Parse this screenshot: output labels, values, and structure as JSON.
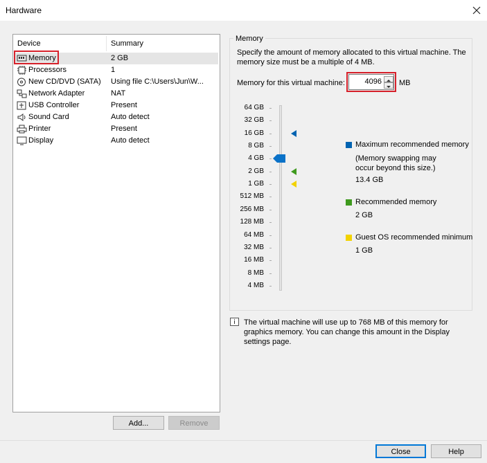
{
  "window": {
    "title": "Hardware",
    "close_icon": "close-icon"
  },
  "device_list": {
    "columns": {
      "device": "Device",
      "summary": "Summary"
    },
    "rows": [
      {
        "name": "Memory",
        "summary": "2 GB",
        "icon": "memory-icon",
        "selected": true
      },
      {
        "name": "Processors",
        "summary": "1",
        "icon": "processor-icon"
      },
      {
        "name": "New CD/DVD (SATA)",
        "summary": "Using file C:\\Users\\Jun\\W...",
        "icon": "cd-dvd-icon"
      },
      {
        "name": "Network Adapter",
        "summary": "NAT",
        "icon": "network-adapter-icon"
      },
      {
        "name": "USB Controller",
        "summary": "Present",
        "icon": "usb-controller-icon"
      },
      {
        "name": "Sound Card",
        "summary": "Auto detect",
        "icon": "sound-card-icon"
      },
      {
        "name": "Printer",
        "summary": "Present",
        "icon": "printer-icon"
      },
      {
        "name": "Display",
        "summary": "Auto detect",
        "icon": "display-icon"
      }
    ],
    "add_label": "Add...",
    "remove_label": "Remove"
  },
  "memory": {
    "group_label": "Memory",
    "description": "Specify the amount of memory allocated to this virtual machine. The memory size must be a multiple of 4 MB.",
    "field_label": "Memory for this virtual machine:",
    "value": "4096",
    "unit": "MB",
    "scale": [
      "64 GB",
      "32 GB",
      "16 GB",
      "8 GB",
      "4 GB",
      "2 GB",
      "1 GB",
      "512 MB",
      "256 MB",
      "128 MB",
      "64 MB",
      "32 MB",
      "16 MB",
      "8 MB",
      "4 MB"
    ],
    "slider_level": "4 GB",
    "legend": {
      "max": {
        "title": "Maximum recommended memory",
        "note": "(Memory swapping may occur beyond this size.)",
        "value": "13.4 GB",
        "color": "#0063b1"
      },
      "recommended": {
        "title": "Recommended memory",
        "value": "2 GB",
        "color": "#3f9a1e"
      },
      "guest_min": {
        "title": "Guest OS recommended minimum",
        "value": "1 GB",
        "color": "#f2d200"
      }
    },
    "info_text": "The virtual machine will use up to 768 MB of this memory for graphics memory. You can change this amount in the Display settings page."
  },
  "footer": {
    "close_label": "Close",
    "help_label": "Help"
  }
}
